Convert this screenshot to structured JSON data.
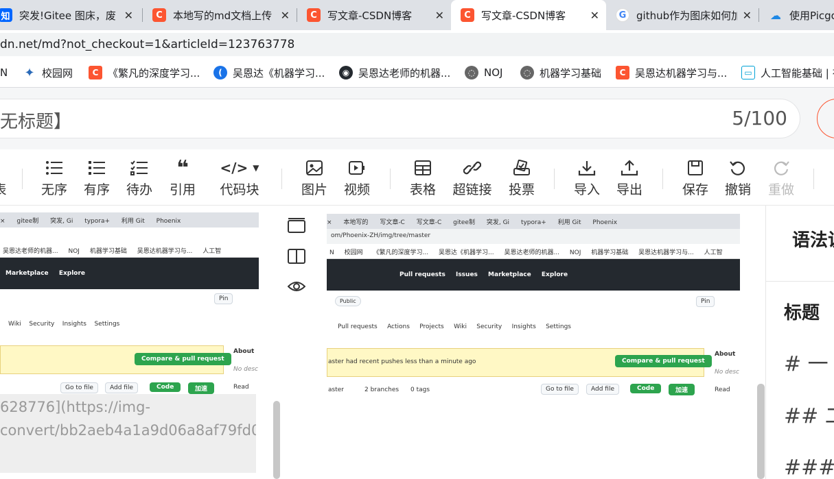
{
  "browser": {
    "tabs": [
      {
        "icon": "zhihu-icon",
        "title": "突发!Gitee 图床，废"
      },
      {
        "icon": "csdn-icon",
        "title": "本地写的md文档上传"
      },
      {
        "icon": "csdn-icon",
        "title": "写文章-CSDN博客"
      },
      {
        "icon": "csdn-icon",
        "title": "写文章-CSDN博客",
        "active": true
      },
      {
        "icon": "google-icon",
        "title": "github作为图床如何加"
      },
      {
        "icon": "cloud-icon",
        "title": "使用Picgo"
      }
    ],
    "address": "dn.net/md?not_checkout=1&articleId=123763778",
    "bookmarks": [
      {
        "icon": "",
        "label": "N"
      },
      {
        "icon": "campus-icon",
        "label": "校园网"
      },
      {
        "icon": "csdn-icon",
        "label": "《繁凡的深度学习..."
      },
      {
        "icon": "blue-icon",
        "label": "吴恩达《机器学习..."
      },
      {
        "icon": "github-icon",
        "label": "吴恩达老师的机器..."
      },
      {
        "icon": "globe-icon",
        "label": "NOJ"
      },
      {
        "icon": "globe-icon",
        "label": "机器学习基础"
      },
      {
        "icon": "csdn-icon",
        "label": "吴恩达机器学习与..."
      },
      {
        "icon": "bilibili-icon",
        "label": "人工智能基础 | 有"
      }
    ]
  },
  "editor": {
    "title_value": "无标题】",
    "title_count": "5/100",
    "toolbar": [
      {
        "icon": "unordered-list-icon",
        "label": "无序"
      },
      {
        "icon": "ordered-list-icon",
        "label": "有序"
      },
      {
        "icon": "todo-list-icon",
        "label": "待办"
      },
      {
        "icon": "quote-icon",
        "label": "引用"
      },
      {
        "icon": "code-block-icon",
        "label": "代码块"
      },
      {
        "icon": "image-icon",
        "label": "图片"
      },
      {
        "icon": "video-icon",
        "label": "视频"
      },
      {
        "icon": "table-icon",
        "label": "表格"
      },
      {
        "icon": "link-icon",
        "label": "超链接"
      },
      {
        "icon": "vote-icon",
        "label": "投票"
      },
      {
        "icon": "import-icon",
        "label": "导入"
      },
      {
        "icon": "export-icon",
        "label": "导出"
      },
      {
        "icon": "save-icon",
        "label": "保存"
      },
      {
        "icon": "undo-icon",
        "label": "撤销"
      },
      {
        "icon": "redo-icon",
        "label": "重做",
        "disabled": true
      }
    ],
    "toolbar_left_fragment": "表",
    "source_text": [
      "628776](https://img-",
      "convert/bb2aeb4a1a9d06a8af79fd0"
    ]
  },
  "embedded_screenshot": {
    "tabs": [
      "×",
      "本地写的",
      "写文章-C",
      "写文章-C",
      "gitee制",
      "突发, Gi",
      "typora+",
      "利用 Git",
      "Phoenix"
    ],
    "url": "om/Phoenix-ZH/img/tree/master",
    "bookmarks": [
      "N",
      "校园网",
      "《繁凡的深度学习...",
      "吴恩达《机器学习...",
      "吴恩达老师的机器...",
      "NOJ",
      "机器学习基础",
      "吴恩达机器学习与...",
      "人工智"
    ],
    "nav": [
      "Pull requests",
      "Issues",
      "Marketplace",
      "Explore"
    ],
    "left_nav": [
      "Marketplace",
      "Explore"
    ],
    "pin": "Pin",
    "public": "Public",
    "repo_tabs": [
      "Pull requests",
      "Actions",
      "Projects",
      "Wiki",
      "Security",
      "Insights",
      "Settings"
    ],
    "left_repo_tabs": [
      "Wiki",
      "Security",
      "Insights",
      "Settings"
    ],
    "banner": "aster had recent pushes less than a minute ago",
    "compare_button": "Compare & pull request",
    "about": "About",
    "no_desc": "No desc",
    "branch": "aster",
    "branches": "2 branches",
    "tags": "0 tags",
    "go_to_file": "Go to file",
    "add_file": "Add file",
    "code": "Code",
    "speedup": "加速",
    "readme": "Read"
  },
  "syntax_panel": {
    "title": "语法说",
    "section": "标题",
    "items": [
      "# 一",
      "## 二",
      "### 三"
    ]
  },
  "colors": {
    "csdn": "#fc5531",
    "zhihu": "#0066ff",
    "github_green": "#2da44e",
    "github_dark": "#24292f"
  }
}
